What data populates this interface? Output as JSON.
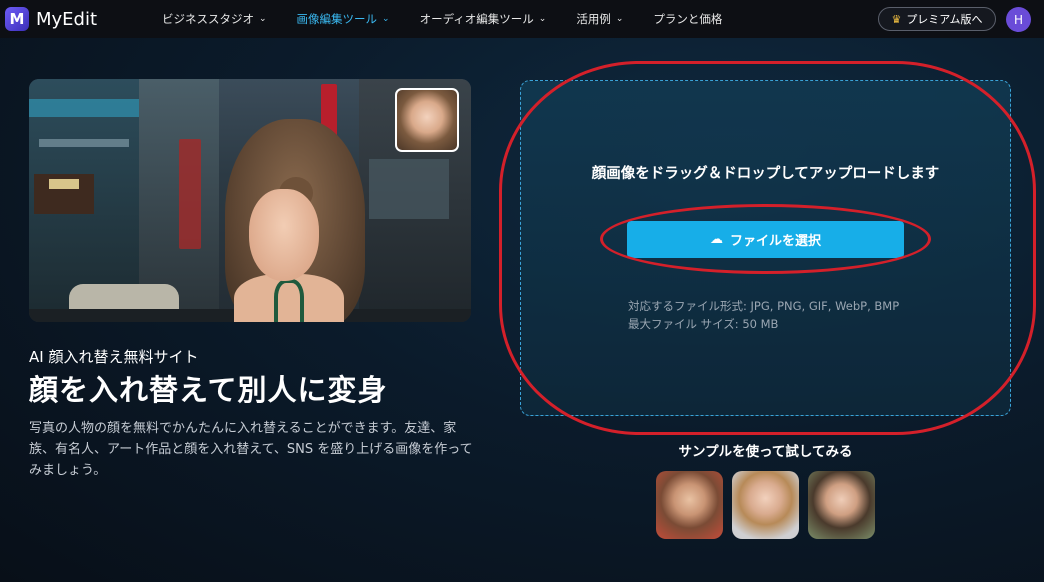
{
  "brand": {
    "name": "MyEdit",
    "logo_icon": "myedit-logo-icon"
  },
  "nav": {
    "items": [
      {
        "label": "ビジネススタジオ"
      },
      {
        "label": "画像編集ツール"
      },
      {
        "label": "オーディオ編集ツール"
      },
      {
        "label": "活用例"
      },
      {
        "label": "プランと価格"
      }
    ],
    "active_index": 1,
    "premium_label": "プレミアム版へ",
    "avatar_initial": "H"
  },
  "hero": {
    "subtitle": "AI 顔入れ替え無料サイト",
    "title": "顔を入れ替えて別人に変身",
    "description": "写真の人物の顔を無料でかんたんに入れ替えることができます。友達、家族、有名人、アート作品と顔を入れ替えて、SNS を盛り上げる画像を作ってみましょう。"
  },
  "upload": {
    "headline": "顔画像をドラッグ＆ドロップしてアップロードします",
    "button_label": "ファイルを選択",
    "formats": "対応するファイル形式: JPG, PNG, GIF, WebP, BMP",
    "max_size": "最大ファイル サイズ: 50 MB"
  },
  "samples": {
    "label": "サンプルを使って試してみる",
    "count": 3
  },
  "colors": {
    "accent": "#17aee8",
    "nav_active": "#3ab8f0",
    "annotation_red": "#d4202a",
    "header_bg": "#0d0f14"
  }
}
